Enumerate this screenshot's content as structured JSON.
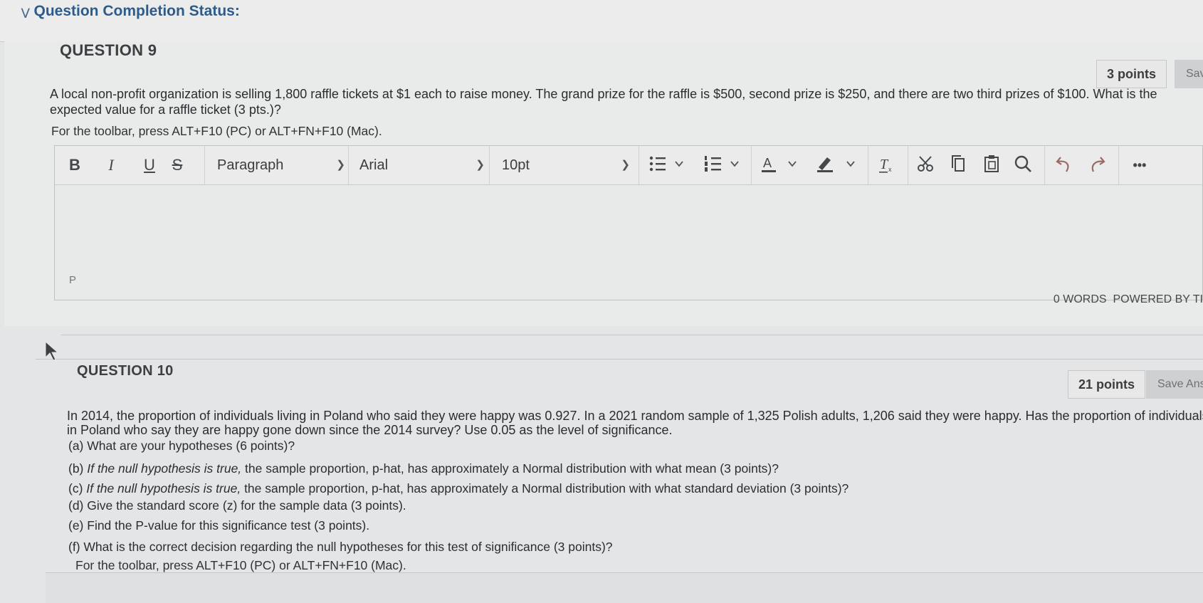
{
  "status": {
    "title": "Question Completion Status:"
  },
  "q9": {
    "heading": "QUESTION 9",
    "points": "3 points",
    "save": "Sav",
    "text_line1": "A local non-profit organization is selling 1,800 raffle tickets at $1 each to raise money. The grand prize for the raffle is $500, second prize is $250, and there are two third prizes of $100. What is the",
    "text_line2": "expected value for a raffle ticket (3 pts.)?",
    "toolbar_hint": "For the toolbar, press ALT+F10 (PC) or ALT+FN+F10 (Mac).",
    "editor": {
      "bold": "B",
      "italic": "I",
      "underline": "U",
      "strike": "S",
      "paragraph": "Paragraph",
      "font": "Arial",
      "size": "10pt",
      "more": "•••",
      "path": "P",
      "words": "0 WORDS",
      "powered": "POWERED BY TI"
    }
  },
  "q10": {
    "heading": "QUESTION 10",
    "points": "21 points",
    "save": "Save Ans",
    "text_line1": "In 2014, the proportion of individuals living in Poland who said they were happy was 0.927. In a 2021 random sample of 1,325 Polish adults, 1,206 said they were happy. Has the proportion of individuals",
    "text_line2": "in Poland who say they are happy gone down since the 2014 survey? Use 0.05 as the level of significance.",
    "a": "(a) What are your hypotheses (6 points)?",
    "b_prefix": "(b) ",
    "b_italic": "If the null hypothesis is true,",
    "b_rest": " the sample proportion, p-hat, has approximately a Normal distribution with what mean (3 points)?",
    "c_prefix": "(c) ",
    "c_italic": "If the null hypothesis is true,",
    "c_rest": " the sample proportion, p-hat, has approximately a Normal distribution with what standard deviation (3 points)?",
    "d": "(d) Give the standard score (z) for the sample data (3 points).",
    "e": "(e) Find the P-value for this significance test (3 points).",
    "f": "(f) What is the correct decision regarding the null hypotheses for this test of significance (3 points)?",
    "toolbar_hint": "For the toolbar, press ALT+F10 (PC) or ALT+FN+F10 (Mac)."
  },
  "icons": {
    "collapse": "chevron-down-icon",
    "cursor": "mouse-pointer-icon"
  }
}
